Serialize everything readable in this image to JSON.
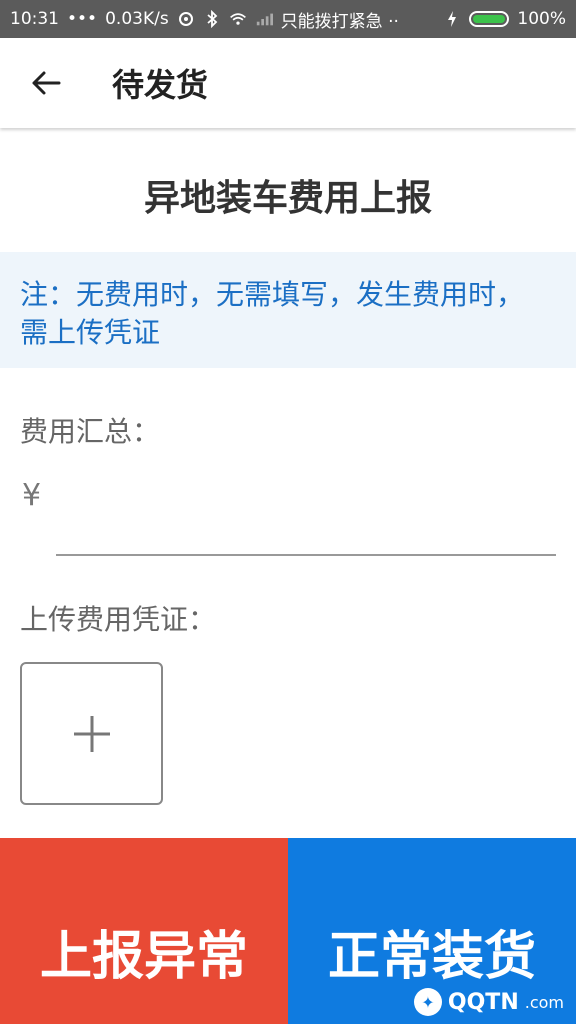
{
  "status_bar": {
    "time": "10:31",
    "dots": "•••",
    "speed": "0.03K/s",
    "carrier": "只能拨打紧急 ··",
    "battery": "100%"
  },
  "app_bar": {
    "title": "待发货"
  },
  "page": {
    "heading": "异地装车费用上报",
    "notice": "注：无费用时，无需填写，发生费用时，需上传凭证",
    "total_label": "费用汇总：",
    "currency_symbol": "¥",
    "amount_value": "",
    "upload_label": "上传费用凭证："
  },
  "buttons": {
    "report_abnormal": "上报异常",
    "normal_loading": "正常装货"
  },
  "watermark": {
    "text": "QQTN",
    "suffix": ".com"
  },
  "colors": {
    "status_bar": "#5b5b5b",
    "notice_bg": "#eef5fb",
    "notice_text": "#1b6fc4",
    "abnormal_btn": "#e84a35",
    "normal_btn": "#0f7be0"
  }
}
